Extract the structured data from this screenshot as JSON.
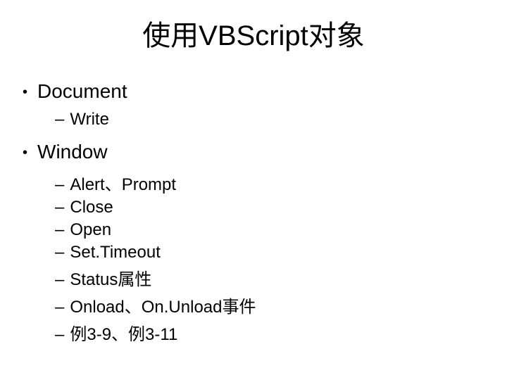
{
  "title": "使用VBScript对象",
  "items": [
    {
      "label": "Document",
      "children": [
        {
          "label": "Write"
        }
      ]
    },
    {
      "label": "Window",
      "children": [
        {
          "label": "Alert、Prompt"
        },
        {
          "label": "Close"
        },
        {
          "label": "Open"
        },
        {
          "label": "Set.Timeout"
        },
        {
          "label": "Status属性"
        },
        {
          "label": "Onload、On.Unload事件"
        },
        {
          "label": "例3-9、例3-11"
        }
      ]
    }
  ]
}
